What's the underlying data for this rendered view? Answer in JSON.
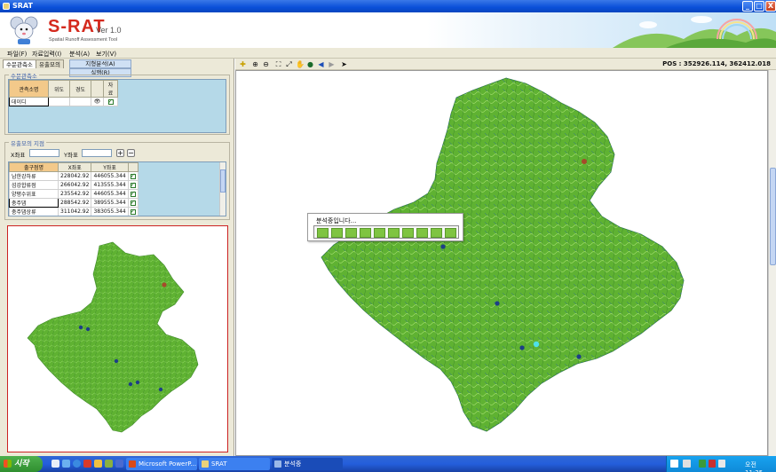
{
  "window": {
    "title": "SRAT",
    "minimize": "_",
    "maximize": "□",
    "close": "X"
  },
  "banner": {
    "title": "S-RAT",
    "version": "Ver 1.0",
    "subtitle": "Spatial Runoff Assessment Tool"
  },
  "menu": [
    "파일(F)",
    "자료입력(I)",
    "분석(A)",
    "보기(V)"
  ],
  "left_panel": {
    "tabs": [
      "수문관측소",
      "유출모의"
    ],
    "sub_buttons": [
      "지형분석(A)",
      "실행(R)"
    ],
    "station_group": {
      "legend": "수문관측소",
      "columns": [
        "관측소명",
        "위도",
        "경도",
        "",
        "자료"
      ],
      "rows": [
        {
          "name": "데이디",
          "lat": "",
          "lon": ""
        }
      ]
    },
    "outlet_group": {
      "legend": "유출모의 지점",
      "x_label": "X좌표",
      "y_label": "Y좌표",
      "add": "+",
      "remove": "−",
      "columns": [
        "출구점명",
        "X좌표",
        "Y좌표"
      ],
      "rows": [
        {
          "name": "남한강하류",
          "x": "228042.92",
          "y": "446055.344"
        },
        {
          "name": "섬강합류점",
          "x": "266042.92",
          "y": "413555.344"
        },
        {
          "name": "양평수위표",
          "x": "235542.92",
          "y": "446055.344"
        },
        {
          "name": "충주댐",
          "x": "288542.92",
          "y": "389555.344"
        },
        {
          "name": "충주댐상류",
          "x": "311042.92",
          "y": "383055.344"
        }
      ]
    }
  },
  "toolbar": {
    "position_label": "POS : 352926.114, 362412.018"
  },
  "dialog": {
    "message": "분석중입니다...",
    "progress_segments": 10,
    "progress": 1.0
  },
  "taskbar": {
    "start": "시작",
    "tasks": [
      "Microsoft PowerP...",
      "SRAT",
      "분석중"
    ],
    "clock": "오전 11:35"
  },
  "colors": {
    "map_fill": "#5fb232",
    "river": "#2f6d93",
    "accent": "#d42a1e"
  },
  "icons": [
    "add-layer-icon",
    "zoom-in-icon",
    "zoom-out-icon",
    "full-extent-icon",
    "fixed-zoom-icon",
    "pan-icon",
    "globe-icon",
    "back-icon",
    "forward-icon",
    "pointer-icon"
  ]
}
